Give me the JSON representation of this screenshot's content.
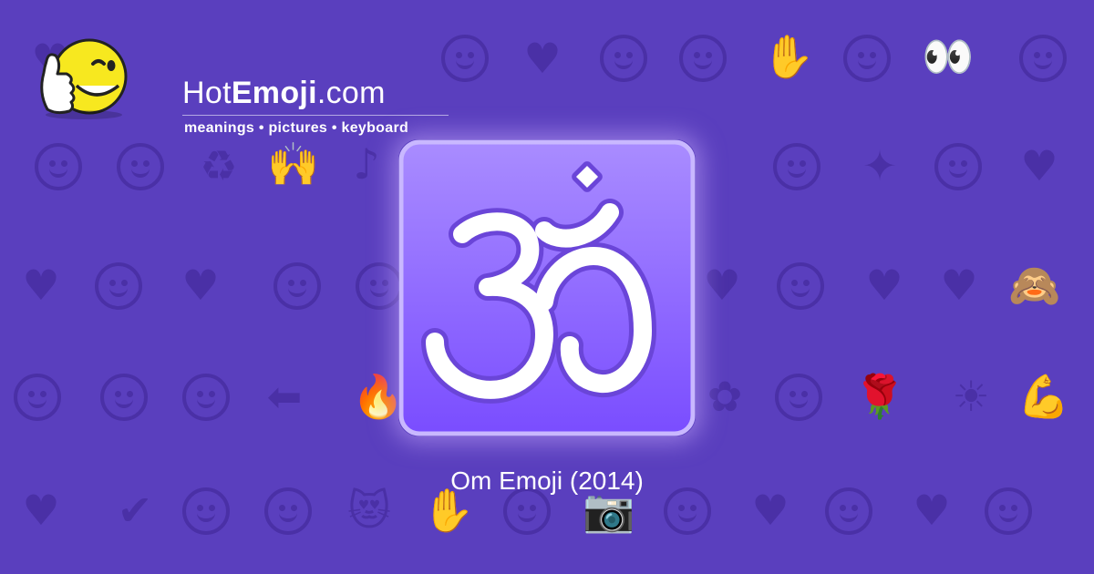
{
  "header": {
    "site_name_prefix": "Hot",
    "site_name_bold": "Emoji",
    "site_name_suffix": ".com",
    "tagline": "meanings • pictures • keyboard",
    "logo_icon": "thumbs-up-wink-face-icon"
  },
  "main": {
    "emoji_icon": "om-icon",
    "caption": "Om Emoji (2014)"
  },
  "background": {
    "pattern_icon": "emoji-pattern-icon"
  },
  "colors": {
    "background": "#5a3fbe",
    "pattern": "#4a30a6",
    "card_top": "#a88bff",
    "card_bottom": "#7a4dff",
    "symbol": "#ffffff"
  }
}
